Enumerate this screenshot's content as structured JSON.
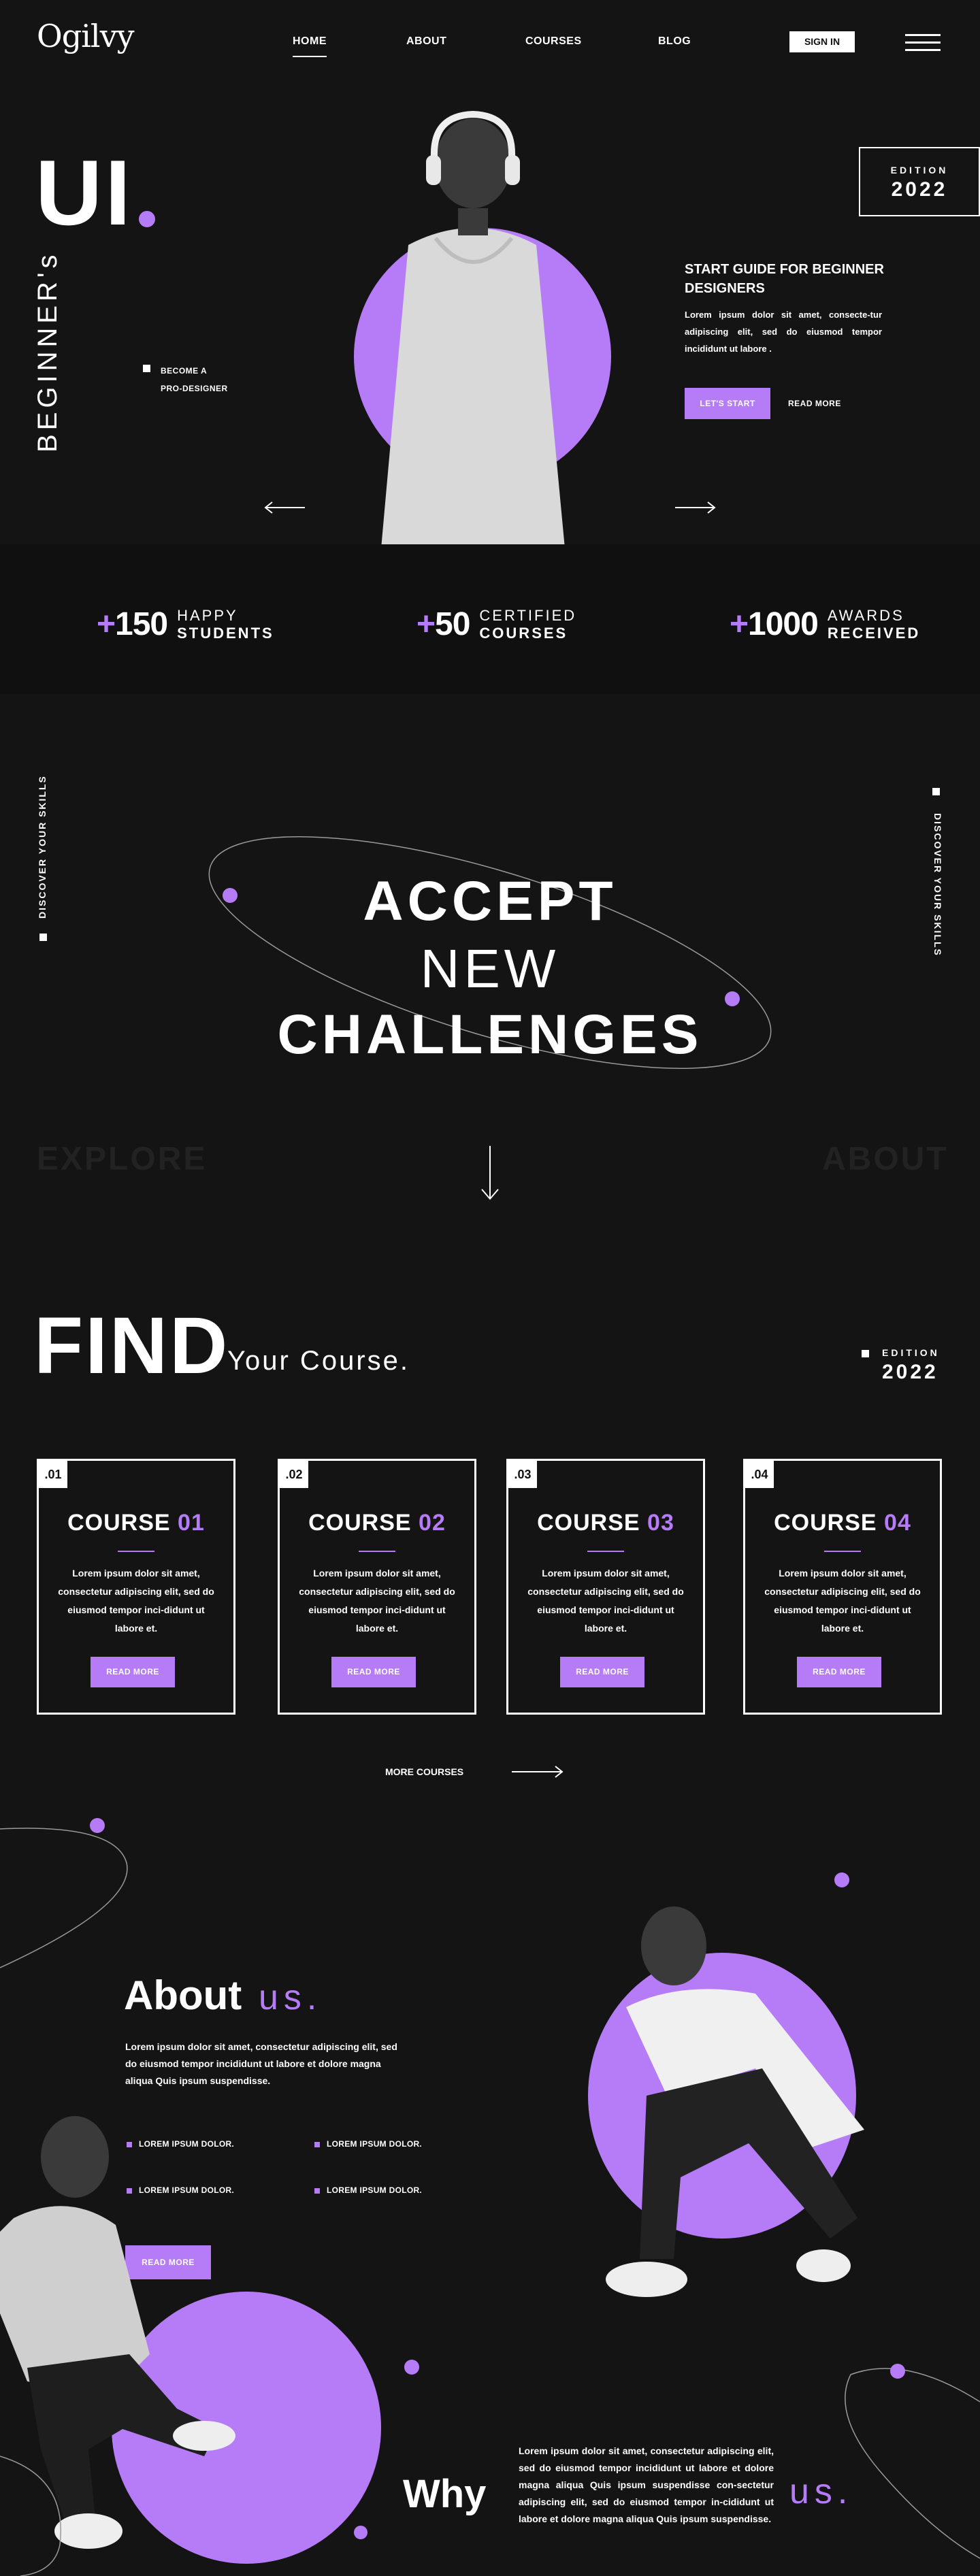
{
  "nav": {
    "logo": "Ogilvy",
    "links": [
      "HOME",
      "ABOUT",
      "COURSES",
      "BLOG"
    ],
    "signin": "SIGN IN"
  },
  "hero": {
    "title": "UI",
    "vertical_text": "BEGINNER's",
    "badge_line1": "BECOME A",
    "badge_line2": "PRO-DESIGNER",
    "edition_label": "EDITION",
    "edition_year": "2022",
    "guide_title": "START GUIDE FOR BEGINNER DESIGNERS",
    "guide_text": "Lorem ipsum dolor sit amet, consecte-tur adipiscing elit, sed do eiusmod tempor incididunt ut labore .",
    "cta_primary": "LET'S START",
    "cta_secondary": "READ MORE"
  },
  "stats": [
    {
      "prefix": "+",
      "num": "150",
      "line1": "HAPPY",
      "line2": "STUDENTS"
    },
    {
      "prefix": "+",
      "num": "50",
      "line1": "CERTIFIED",
      "line2": "COURSES"
    },
    {
      "prefix": "+",
      "num": "1000",
      "line1": "AWARDS",
      "line2": "RECEIVED"
    }
  ],
  "challenge": {
    "side_left": "DISCOVER YOUR SKILLS",
    "side_right": "DISCOVER YOUR SKILLS",
    "line1": "ACCEPT",
    "line2": "NEW",
    "line3": "CHALLENGES",
    "ghost_left": "EXPLORE",
    "ghost_right": "ABOUT"
  },
  "find": {
    "title": "FIND",
    "subtitle": "Your Course.",
    "edition_label": "EDITION",
    "edition_year": "2022",
    "courses": [
      {
        "num": ".01",
        "title": "COURSE",
        "index": "01",
        "text": "Lorem ipsum dolor sit amet, consectetur adipiscing elit, sed do eiusmod tempor inci-didunt ut labore et.",
        "button": "READ MORE"
      },
      {
        "num": ".02",
        "title": "COURSE",
        "index": "02",
        "text": "Lorem ipsum dolor sit amet, consectetur adipiscing elit, sed do eiusmod tempor inci-didunt ut labore et.",
        "button": "READ MORE"
      },
      {
        "num": ".03",
        "title": "COURSE",
        "index": "03",
        "text": "Lorem ipsum dolor sit amet, consectetur adipiscing elit, sed do eiusmod tempor inci-didunt ut labore et.",
        "button": "READ MORE"
      },
      {
        "num": ".04",
        "title": "COURSE",
        "index": "04",
        "text": "Lorem ipsum dolor sit amet, consectetur adipiscing elit, sed do eiusmod tempor inci-didunt ut labore et.",
        "button": "READ MORE"
      }
    ],
    "more": "MORE COURSES"
  },
  "about": {
    "title": "About",
    "accent": "us.",
    "text": "Lorem ipsum dolor sit amet, consectetur adipiscing elit, sed do eiusmod tempor incididunt ut labore et dolore magna aliqua Quis ipsum suspendisse.",
    "features": [
      "LOREM IPSUM DOLOR.",
      "LOREM IPSUM DOLOR.",
      "LOREM IPSUM DOLOR.",
      "LOREM IPSUM DOLOR."
    ],
    "button": "READ MORE"
  },
  "why": {
    "title": "Why",
    "accent": "us.",
    "text": "Lorem ipsum dolor sit amet, consectetur adipiscing elit, sed do eiusmod tempor incididunt ut labore et dolore magna aliqua Quis ipsum suspendisse con-sectetur adipiscing elit, sed do eiusmod tempor in-cididunt ut labore et dolore magna aliqua Quis ipsum suspendisse."
  },
  "colors": {
    "accent": "#b67cf7",
    "background": "#151415",
    "stats_band": "#111011",
    "ghost_text": "#232223"
  }
}
